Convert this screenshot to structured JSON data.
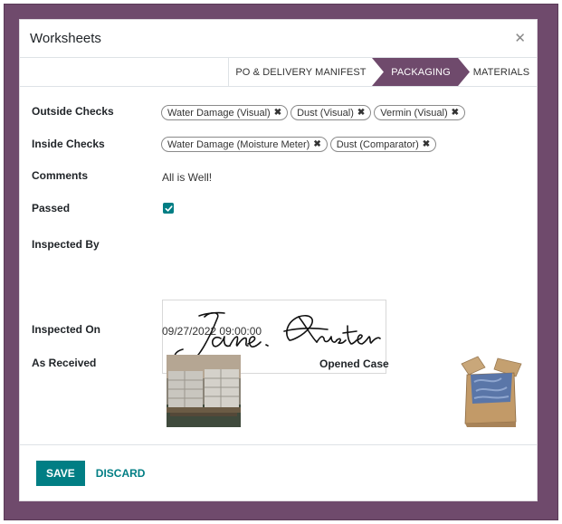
{
  "modal": {
    "title": "Worksheets"
  },
  "stages": [
    {
      "label": "PO & DELIVERY MANIFEST",
      "active": false
    },
    {
      "label": "PACKAGING",
      "active": true
    },
    {
      "label": "MATERIALS",
      "active": false
    }
  ],
  "fields": {
    "outside_checks": {
      "label": "Outside Checks",
      "tags": [
        "Water Damage (Visual)",
        "Dust (Visual)",
        "Vermin (Visual)"
      ]
    },
    "inside_checks": {
      "label": "Inside Checks",
      "tags": [
        "Water Damage (Moisture Meter)",
        "Dust (Comparator)"
      ]
    },
    "comments": {
      "label": "Comments",
      "value": "All is Well!"
    },
    "passed": {
      "label": "Passed",
      "checked": true
    },
    "inspected_by": {
      "label": "Inspected By"
    },
    "inspected_on": {
      "label": "Inspected On",
      "value": "09/27/2022 09:00:00"
    },
    "as_received": {
      "label": "As Received"
    },
    "opened_case": {
      "label": "Opened Case"
    }
  },
  "footer": {
    "save_label": "SAVE",
    "discard_label": "DISCARD"
  },
  "colors": {
    "brand": "#6f4a6c",
    "accent": "#017e84"
  },
  "icons": {
    "close": "close-icon",
    "tag_remove": "remove-tag-icon",
    "check": "checkmark-icon"
  }
}
